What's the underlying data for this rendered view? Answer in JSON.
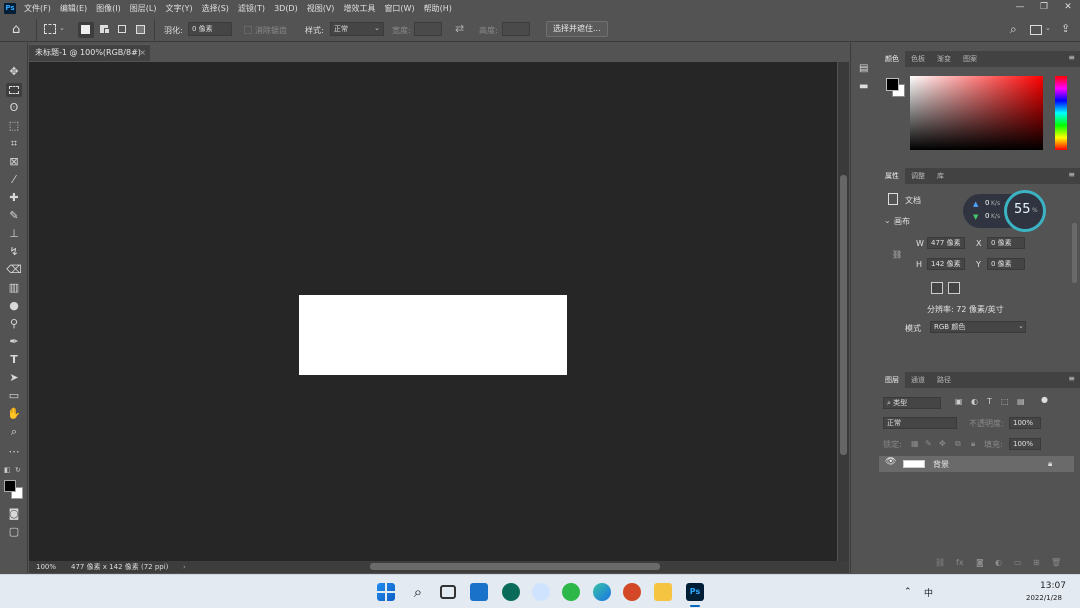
{
  "app": {
    "logo_text": "Ps"
  },
  "menubar": {
    "items": [
      "文件(F)",
      "编辑(E)",
      "图像(I)",
      "图层(L)",
      "文字(Y)",
      "选择(S)",
      "滤镜(T)",
      "3D(D)",
      "视图(V)",
      "增效工具",
      "窗口(W)",
      "帮助(H)"
    ]
  },
  "options": {
    "feather_label": "羽化:",
    "feather_value": "0 像素",
    "antialias_label": "消除锯齿",
    "style_label": "样式:",
    "style_value": "正常",
    "width_label": "宽度:",
    "height_label": "高度:",
    "select_mask_button": "选择并遮住..."
  },
  "document": {
    "tab_title": "未标题-1 @ 100%(RGB/8#)",
    "zoom": "100%",
    "info": "477 像素 x 142 像素 (72 ppi)"
  },
  "color_panel": {
    "tabs": [
      "颜色",
      "色板",
      "渐变",
      "图案"
    ],
    "foreground": "#000000",
    "background": "#ffffff"
  },
  "properties_panel": {
    "tabs": [
      "属性",
      "调整",
      "库"
    ],
    "doc_label": "文档",
    "canvas_section": "画布",
    "w_label": "W",
    "w_value": "477 像素",
    "h_label": "H",
    "h_value": "142 像素",
    "x_label": "X",
    "x_value": "0 像素",
    "y_label": "Y",
    "y_value": "0 像素",
    "resolution": "分辨率: 72 像素/英寸",
    "mode_label": "模式",
    "mode_value": "RGB 颜色"
  },
  "net_widget": {
    "upload": "0",
    "upload_unit": "K/s",
    "download": "0",
    "download_unit": "K/s",
    "percent": "55",
    "percent_unit": "%"
  },
  "layers_panel": {
    "tabs": [
      "图层",
      "通道",
      "路径"
    ],
    "filter_label": "类型",
    "blend_mode": "正常",
    "opacity_label": "不透明度:",
    "opacity_value": "100%",
    "lock_label": "锁定:",
    "fill_label": "填充:",
    "fill_value": "100%",
    "layers": [
      {
        "name": "背景"
      }
    ]
  },
  "taskbar": {
    "status_text": "中",
    "clock_time": "13:07",
    "clock_date": "2022/1/28"
  },
  "colors": {
    "ui_bg": "#535353",
    "doc_bg": "#262626",
    "accent_blue": "#31a8ff"
  }
}
